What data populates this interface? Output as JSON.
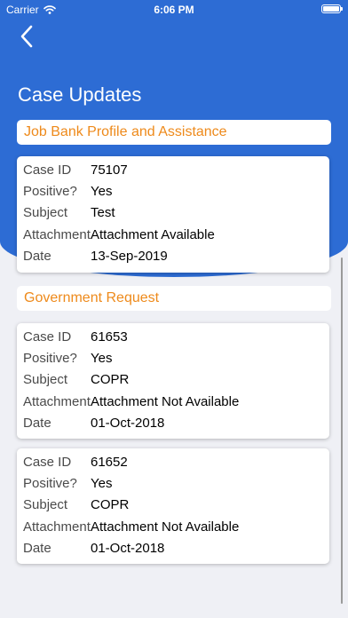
{
  "status_bar": {
    "carrier": "Carrier",
    "time": "6:06 PM"
  },
  "header": {
    "title": "Case Updates"
  },
  "sections": [
    {
      "title": "Job Bank Profile and Assistance",
      "cases": [
        {
          "case_id_label": "Case ID",
          "case_id": "75107",
          "positive_label": "Positive?",
          "positive": "Yes",
          "subject_label": "Subject",
          "subject": "Test",
          "attachment_label": "Attachment",
          "attachment": "Attachment Available",
          "date_label": "Date",
          "date": "13-Sep-2019"
        }
      ]
    },
    {
      "title": "Government Request",
      "cases": [
        {
          "case_id_label": "Case ID",
          "case_id": "61653",
          "positive_label": "Positive?",
          "positive": "Yes",
          "subject_label": "Subject",
          "subject": "COPR",
          "attachment_label": "Attachment",
          "attachment": "Attachment Not Available",
          "date_label": "Date",
          "date": "01-Oct-2018"
        },
        {
          "case_id_label": "Case ID",
          "case_id": "61652",
          "positive_label": "Positive?",
          "positive": "Yes",
          "subject_label": "Subject",
          "subject": "COPR",
          "attachment_label": "Attachment",
          "attachment": "Attachment Not Available",
          "date_label": "Date",
          "date": "01-Oct-2018"
        }
      ]
    }
  ],
  "colors": {
    "primary": "#2d6cd4",
    "section_title": "#ee8a1b",
    "background": "#eff0f5"
  }
}
